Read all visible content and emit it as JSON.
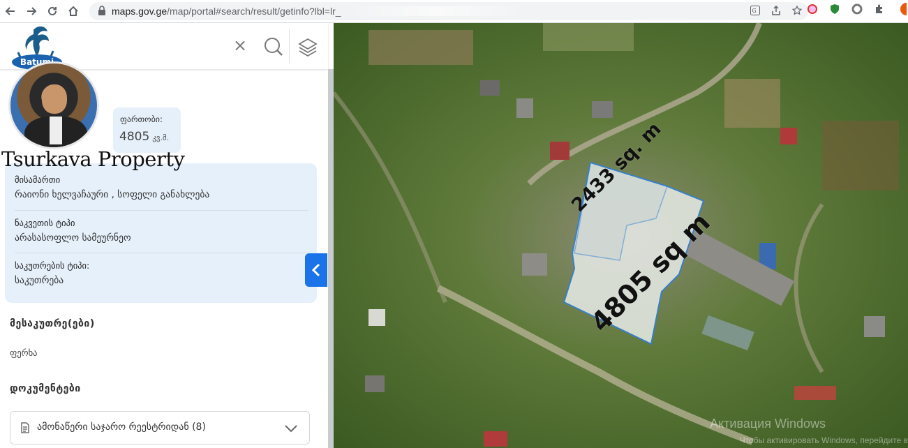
{
  "browser": {
    "url_host": "maps.gov.ge",
    "url_path": "/map/portal#search/result/getinfo?lbl=lr_",
    "icons": [
      "back-icon",
      "forward-icon",
      "reload-icon",
      "home-icon",
      "lock-icon",
      "translate-icon",
      "share-icon",
      "star-icon",
      "extension-icons"
    ]
  },
  "search": {
    "clear_icon": "close-icon",
    "search_icon": "search-icon",
    "layers_icon": "layers-icon"
  },
  "logo": {
    "text": "Batumi",
    "subtext": "realtor"
  },
  "area": {
    "label": "ფართობი:",
    "value": "4805",
    "unit": "კვ.მ."
  },
  "brand": "Tsurkava Property",
  "details": [
    {
      "key": "მისამართი",
      "value": "რაიონი ხელვაჩაური , სოფელი განახლება"
    },
    {
      "key": "ნაკვეთის ტიპი",
      "value": "არასასოფლო სამეურნეო"
    },
    {
      "key": "საკუთრების ტიპი:",
      "value": "საკუთრება"
    }
  ],
  "owners": {
    "title": "მესაკუთრე(ები)",
    "name": "ფერხა"
  },
  "documents": {
    "title": "დოკუმენტები",
    "item": "ამონაწერი საჯარო რეესტრიდან (8)"
  },
  "map": {
    "label_small": "2433 sq. m",
    "label_large": "4805 sq m",
    "watermark": "Активация Windows",
    "watermark_sub": "Чтобы активировать Windows, перейдите в"
  }
}
